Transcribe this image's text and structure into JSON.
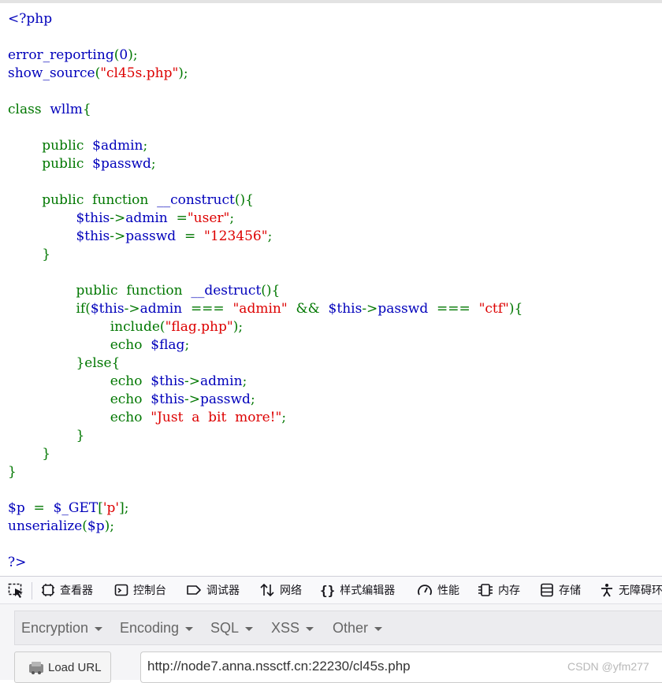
{
  "source_code": {
    "lines": [
      [
        {
          "t": "<?php",
          "c": "def"
        }
      ],
      [],
      [
        {
          "t": "error_reporting",
          "c": "def"
        },
        {
          "t": "(",
          "c": "kw"
        },
        {
          "t": "0",
          "c": "def"
        },
        {
          "t": ");",
          "c": "kw"
        }
      ],
      [
        {
          "t": "show_source",
          "c": "def"
        },
        {
          "t": "(",
          "c": "kw"
        },
        {
          "t": "\"cl45s.php\"",
          "c": "str"
        },
        {
          "t": ");",
          "c": "kw"
        }
      ],
      [],
      [
        {
          "t": "class  ",
          "c": "kw"
        },
        {
          "t": "wllm",
          "c": "def"
        },
        {
          "t": "{",
          "c": "kw"
        }
      ],
      [],
      [
        {
          "t": "        public  ",
          "c": "kw"
        },
        {
          "t": "$admin",
          "c": "def"
        },
        {
          "t": ";",
          "c": "kw"
        }
      ],
      [
        {
          "t": "        public  ",
          "c": "kw"
        },
        {
          "t": "$passwd",
          "c": "def"
        },
        {
          "t": ";",
          "c": "kw"
        }
      ],
      [],
      [
        {
          "t": "        public  function  ",
          "c": "kw"
        },
        {
          "t": "__construct",
          "c": "def"
        },
        {
          "t": "(){",
          "c": "kw"
        }
      ],
      [
        {
          "t": "                ",
          "c": "def"
        },
        {
          "t": "$this",
          "c": "def"
        },
        {
          "t": "->",
          "c": "kw"
        },
        {
          "t": "admin  ",
          "c": "def"
        },
        {
          "t": "=",
          "c": "kw"
        },
        {
          "t": "\"user\"",
          "c": "str"
        },
        {
          "t": ";",
          "c": "kw"
        }
      ],
      [
        {
          "t": "                ",
          "c": "def"
        },
        {
          "t": "$this",
          "c": "def"
        },
        {
          "t": "->",
          "c": "kw"
        },
        {
          "t": "passwd  ",
          "c": "def"
        },
        {
          "t": "=  ",
          "c": "kw"
        },
        {
          "t": "\"123456\"",
          "c": "str"
        },
        {
          "t": ";",
          "c": "kw"
        }
      ],
      [
        {
          "t": "        }",
          "c": "kw"
        }
      ],
      [],
      [
        {
          "t": "                public  function  ",
          "c": "kw"
        },
        {
          "t": "__destruct",
          "c": "def"
        },
        {
          "t": "(){",
          "c": "kw"
        }
      ],
      [
        {
          "t": "                if(",
          "c": "kw"
        },
        {
          "t": "$this",
          "c": "def"
        },
        {
          "t": "->",
          "c": "kw"
        },
        {
          "t": "admin  ",
          "c": "def"
        },
        {
          "t": "===  ",
          "c": "kw"
        },
        {
          "t": "\"admin\"  ",
          "c": "str"
        },
        {
          "t": "&&  ",
          "c": "kw"
        },
        {
          "t": "$this",
          "c": "def"
        },
        {
          "t": "->",
          "c": "kw"
        },
        {
          "t": "passwd  ",
          "c": "def"
        },
        {
          "t": "===  ",
          "c": "kw"
        },
        {
          "t": "\"ctf\"",
          "c": "str"
        },
        {
          "t": "){",
          "c": "kw"
        }
      ],
      [
        {
          "t": "                        include(",
          "c": "kw"
        },
        {
          "t": "\"flag.php\"",
          "c": "str"
        },
        {
          "t": ");",
          "c": "kw"
        }
      ],
      [
        {
          "t": "                        echo  ",
          "c": "kw"
        },
        {
          "t": "$flag",
          "c": "def"
        },
        {
          "t": ";",
          "c": "kw"
        }
      ],
      [
        {
          "t": "                }else{",
          "c": "kw"
        }
      ],
      [
        {
          "t": "                        echo  ",
          "c": "kw"
        },
        {
          "t": "$this",
          "c": "def"
        },
        {
          "t": "->",
          "c": "kw"
        },
        {
          "t": "admin",
          "c": "def"
        },
        {
          "t": ";",
          "c": "kw"
        }
      ],
      [
        {
          "t": "                        echo  ",
          "c": "kw"
        },
        {
          "t": "$this",
          "c": "def"
        },
        {
          "t": "->",
          "c": "kw"
        },
        {
          "t": "passwd",
          "c": "def"
        },
        {
          "t": ";",
          "c": "kw"
        }
      ],
      [
        {
          "t": "                        echo  ",
          "c": "kw"
        },
        {
          "t": "\"Just  a  bit  more!\"",
          "c": "str"
        },
        {
          "t": ";",
          "c": "kw"
        }
      ],
      [
        {
          "t": "                }",
          "c": "kw"
        }
      ],
      [
        {
          "t": "        }",
          "c": "kw"
        }
      ],
      [
        {
          "t": "}",
          "c": "kw"
        }
      ],
      [],
      [
        {
          "t": "$p  ",
          "c": "def"
        },
        {
          "t": "=  ",
          "c": "kw"
        },
        {
          "t": "$_GET",
          "c": "def"
        },
        {
          "t": "[",
          "c": "kw"
        },
        {
          "t": "'p'",
          "c": "str"
        },
        {
          "t": "];",
          "c": "kw"
        }
      ],
      [
        {
          "t": "unserialize",
          "c": "def"
        },
        {
          "t": "(",
          "c": "kw"
        },
        {
          "t": "$p",
          "c": "def"
        },
        {
          "t": ");",
          "c": "kw"
        }
      ],
      [],
      [
        {
          "t": "?>",
          "c": "def"
        }
      ]
    ]
  },
  "devtools": {
    "tabs": [
      {
        "name": "inspector",
        "label": "查看器",
        "icon": "inspector-icon"
      },
      {
        "name": "console",
        "label": "控制台",
        "icon": "console-icon"
      },
      {
        "name": "debugger",
        "label": "调试器",
        "icon": "debugger-icon"
      },
      {
        "name": "network",
        "label": "网络",
        "icon": "network-icon"
      },
      {
        "name": "style-editor",
        "label": "样式编辑器",
        "icon": "braces-icon"
      },
      {
        "name": "performance",
        "label": "性能",
        "icon": "gauge-icon"
      },
      {
        "name": "memory",
        "label": "内存",
        "icon": "memory-icon"
      },
      {
        "name": "storage",
        "label": "存储",
        "icon": "storage-icon"
      },
      {
        "name": "accessibility",
        "label": "无障碍环",
        "icon": "accessibility-icon"
      }
    ]
  },
  "hackbar": {
    "menu": [
      {
        "label": "Encryption"
      },
      {
        "label": "Encoding"
      },
      {
        "label": "SQL"
      },
      {
        "label": "XSS"
      },
      {
        "label": "Other"
      }
    ],
    "load_url_label": "Load URL",
    "url_value": "http://node7.anna.nssctf.cn:22230/cl45s.php"
  },
  "watermark": "CSDN @yfm277",
  "colors": {
    "keyword": "#007700",
    "string": "#dd0000",
    "default": "#0000bb"
  }
}
